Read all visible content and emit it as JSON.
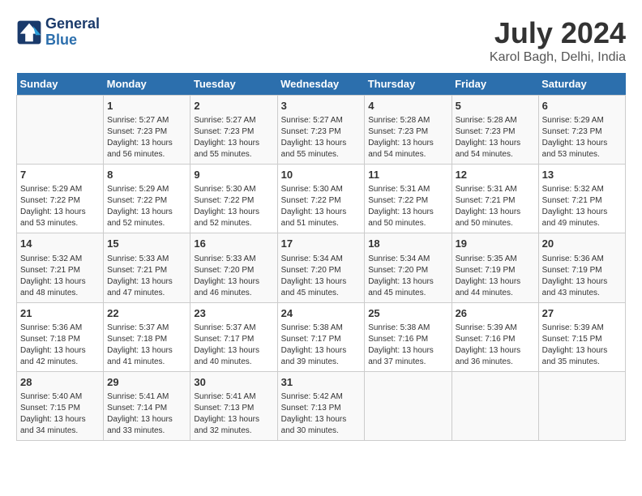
{
  "header": {
    "logo_line1": "General",
    "logo_line2": "Blue",
    "month_year": "July 2024",
    "location": "Karol Bagh, Delhi, India"
  },
  "days_of_week": [
    "Sunday",
    "Monday",
    "Tuesday",
    "Wednesday",
    "Thursday",
    "Friday",
    "Saturday"
  ],
  "weeks": [
    [
      {
        "day": "",
        "info": ""
      },
      {
        "day": "1",
        "info": "Sunrise: 5:27 AM\nSunset: 7:23 PM\nDaylight: 13 hours\nand 56 minutes."
      },
      {
        "day": "2",
        "info": "Sunrise: 5:27 AM\nSunset: 7:23 PM\nDaylight: 13 hours\nand 55 minutes."
      },
      {
        "day": "3",
        "info": "Sunrise: 5:27 AM\nSunset: 7:23 PM\nDaylight: 13 hours\nand 55 minutes."
      },
      {
        "day": "4",
        "info": "Sunrise: 5:28 AM\nSunset: 7:23 PM\nDaylight: 13 hours\nand 54 minutes."
      },
      {
        "day": "5",
        "info": "Sunrise: 5:28 AM\nSunset: 7:23 PM\nDaylight: 13 hours\nand 54 minutes."
      },
      {
        "day": "6",
        "info": "Sunrise: 5:29 AM\nSunset: 7:23 PM\nDaylight: 13 hours\nand 53 minutes."
      }
    ],
    [
      {
        "day": "7",
        "info": "Sunrise: 5:29 AM\nSunset: 7:22 PM\nDaylight: 13 hours\nand 53 minutes."
      },
      {
        "day": "8",
        "info": "Sunrise: 5:29 AM\nSunset: 7:22 PM\nDaylight: 13 hours\nand 52 minutes."
      },
      {
        "day": "9",
        "info": "Sunrise: 5:30 AM\nSunset: 7:22 PM\nDaylight: 13 hours\nand 52 minutes."
      },
      {
        "day": "10",
        "info": "Sunrise: 5:30 AM\nSunset: 7:22 PM\nDaylight: 13 hours\nand 51 minutes."
      },
      {
        "day": "11",
        "info": "Sunrise: 5:31 AM\nSunset: 7:22 PM\nDaylight: 13 hours\nand 50 minutes."
      },
      {
        "day": "12",
        "info": "Sunrise: 5:31 AM\nSunset: 7:21 PM\nDaylight: 13 hours\nand 50 minutes."
      },
      {
        "day": "13",
        "info": "Sunrise: 5:32 AM\nSunset: 7:21 PM\nDaylight: 13 hours\nand 49 minutes."
      }
    ],
    [
      {
        "day": "14",
        "info": "Sunrise: 5:32 AM\nSunset: 7:21 PM\nDaylight: 13 hours\nand 48 minutes."
      },
      {
        "day": "15",
        "info": "Sunrise: 5:33 AM\nSunset: 7:21 PM\nDaylight: 13 hours\nand 47 minutes."
      },
      {
        "day": "16",
        "info": "Sunrise: 5:33 AM\nSunset: 7:20 PM\nDaylight: 13 hours\nand 46 minutes."
      },
      {
        "day": "17",
        "info": "Sunrise: 5:34 AM\nSunset: 7:20 PM\nDaylight: 13 hours\nand 45 minutes."
      },
      {
        "day": "18",
        "info": "Sunrise: 5:34 AM\nSunset: 7:20 PM\nDaylight: 13 hours\nand 45 minutes."
      },
      {
        "day": "19",
        "info": "Sunrise: 5:35 AM\nSunset: 7:19 PM\nDaylight: 13 hours\nand 44 minutes."
      },
      {
        "day": "20",
        "info": "Sunrise: 5:36 AM\nSunset: 7:19 PM\nDaylight: 13 hours\nand 43 minutes."
      }
    ],
    [
      {
        "day": "21",
        "info": "Sunrise: 5:36 AM\nSunset: 7:18 PM\nDaylight: 13 hours\nand 42 minutes."
      },
      {
        "day": "22",
        "info": "Sunrise: 5:37 AM\nSunset: 7:18 PM\nDaylight: 13 hours\nand 41 minutes."
      },
      {
        "day": "23",
        "info": "Sunrise: 5:37 AM\nSunset: 7:17 PM\nDaylight: 13 hours\nand 40 minutes."
      },
      {
        "day": "24",
        "info": "Sunrise: 5:38 AM\nSunset: 7:17 PM\nDaylight: 13 hours\nand 39 minutes."
      },
      {
        "day": "25",
        "info": "Sunrise: 5:38 AM\nSunset: 7:16 PM\nDaylight: 13 hours\nand 37 minutes."
      },
      {
        "day": "26",
        "info": "Sunrise: 5:39 AM\nSunset: 7:16 PM\nDaylight: 13 hours\nand 36 minutes."
      },
      {
        "day": "27",
        "info": "Sunrise: 5:39 AM\nSunset: 7:15 PM\nDaylight: 13 hours\nand 35 minutes."
      }
    ],
    [
      {
        "day": "28",
        "info": "Sunrise: 5:40 AM\nSunset: 7:15 PM\nDaylight: 13 hours\nand 34 minutes."
      },
      {
        "day": "29",
        "info": "Sunrise: 5:41 AM\nSunset: 7:14 PM\nDaylight: 13 hours\nand 33 minutes."
      },
      {
        "day": "30",
        "info": "Sunrise: 5:41 AM\nSunset: 7:13 PM\nDaylight: 13 hours\nand 32 minutes."
      },
      {
        "day": "31",
        "info": "Sunrise: 5:42 AM\nSunset: 7:13 PM\nDaylight: 13 hours\nand 30 minutes."
      },
      {
        "day": "",
        "info": ""
      },
      {
        "day": "",
        "info": ""
      },
      {
        "day": "",
        "info": ""
      }
    ]
  ]
}
